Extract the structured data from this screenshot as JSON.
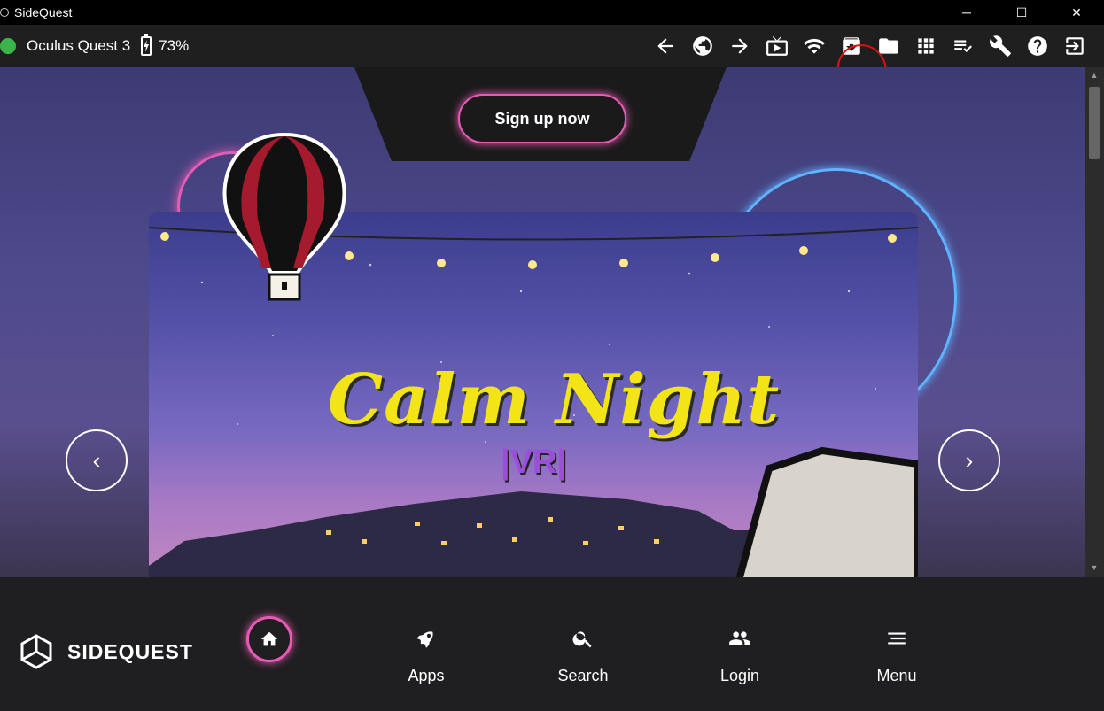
{
  "window": {
    "title": "SideQuest",
    "minimize": "─",
    "maximize": "☐",
    "close": "✕"
  },
  "toolbar": {
    "status_color": "#3bb54a",
    "device_name": "Oculus Quest 3",
    "battery_percent": "73%",
    "icons": [
      "back-icon",
      "globe-icon",
      "forward-icon",
      "tv-icon",
      "wifi-icon",
      "archive-download-icon",
      "folder-icon",
      "grid-icon",
      "tasks-icon",
      "wrench-icon",
      "help-icon",
      "exit-icon"
    ]
  },
  "hero": {
    "signup_label": "Sign up now",
    "banner_title": "Calm Night",
    "banner_subtitle": "|VR|",
    "prev_label": "‹",
    "next_label": "›"
  },
  "bottom_nav": {
    "brand": "SIDEQUEST",
    "items": [
      {
        "label": "Apps",
        "icon": "rocket-icon"
      },
      {
        "label": "Search",
        "icon": "search-icon"
      },
      {
        "label": "Login",
        "icon": "people-icon"
      },
      {
        "label": "Menu",
        "icon": "menu-icon"
      }
    ]
  },
  "colors": {
    "accent_pink": "#e85bb4",
    "accent_blue": "#5fb3ff",
    "title_yellow": "#f2e416"
  }
}
